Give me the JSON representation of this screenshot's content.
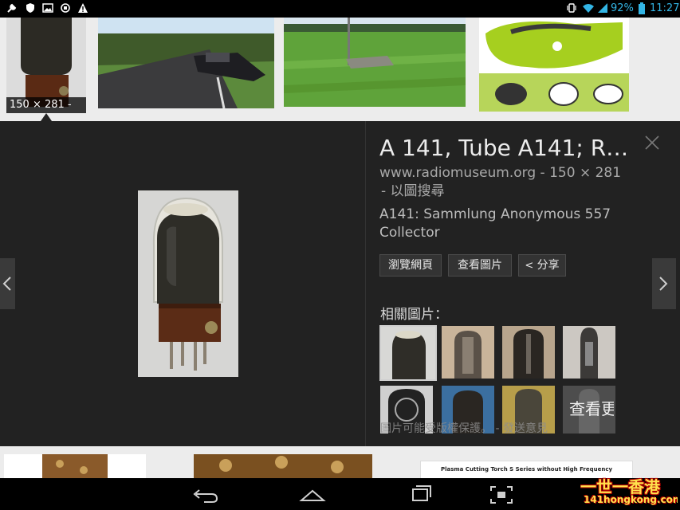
{
  "status_bar": {
    "battery": "92%",
    "time": "11:27"
  },
  "top_results": {
    "size_badge": "150 × 281 -"
  },
  "detail": {
    "title": "A 141, Tube A141; R…",
    "source": "www.radiomuseum.org - 150 × 281",
    "search_by_image": "- 以圖搜尋",
    "description": "A141: Sammlung Anonymous 557 Collector",
    "buttons": {
      "visit_page": "瀏覽網頁",
      "view_image": "查看圖片",
      "share": "分享"
    },
    "related_label": "相關圖片：",
    "copyright_notice": "圖片可能受版權保護。 - 發送意見",
    "see_more": "查看更多"
  },
  "bottom_results": {
    "doc_caption": "Plasma Cutting Torch S Series without High Frequency"
  },
  "watermark": {
    "logo": "一世一香港",
    "url": "141hongkong.com"
  },
  "colors": {
    "panel_bg": "#222222",
    "accent_green": "#a6cf1f"
  }
}
